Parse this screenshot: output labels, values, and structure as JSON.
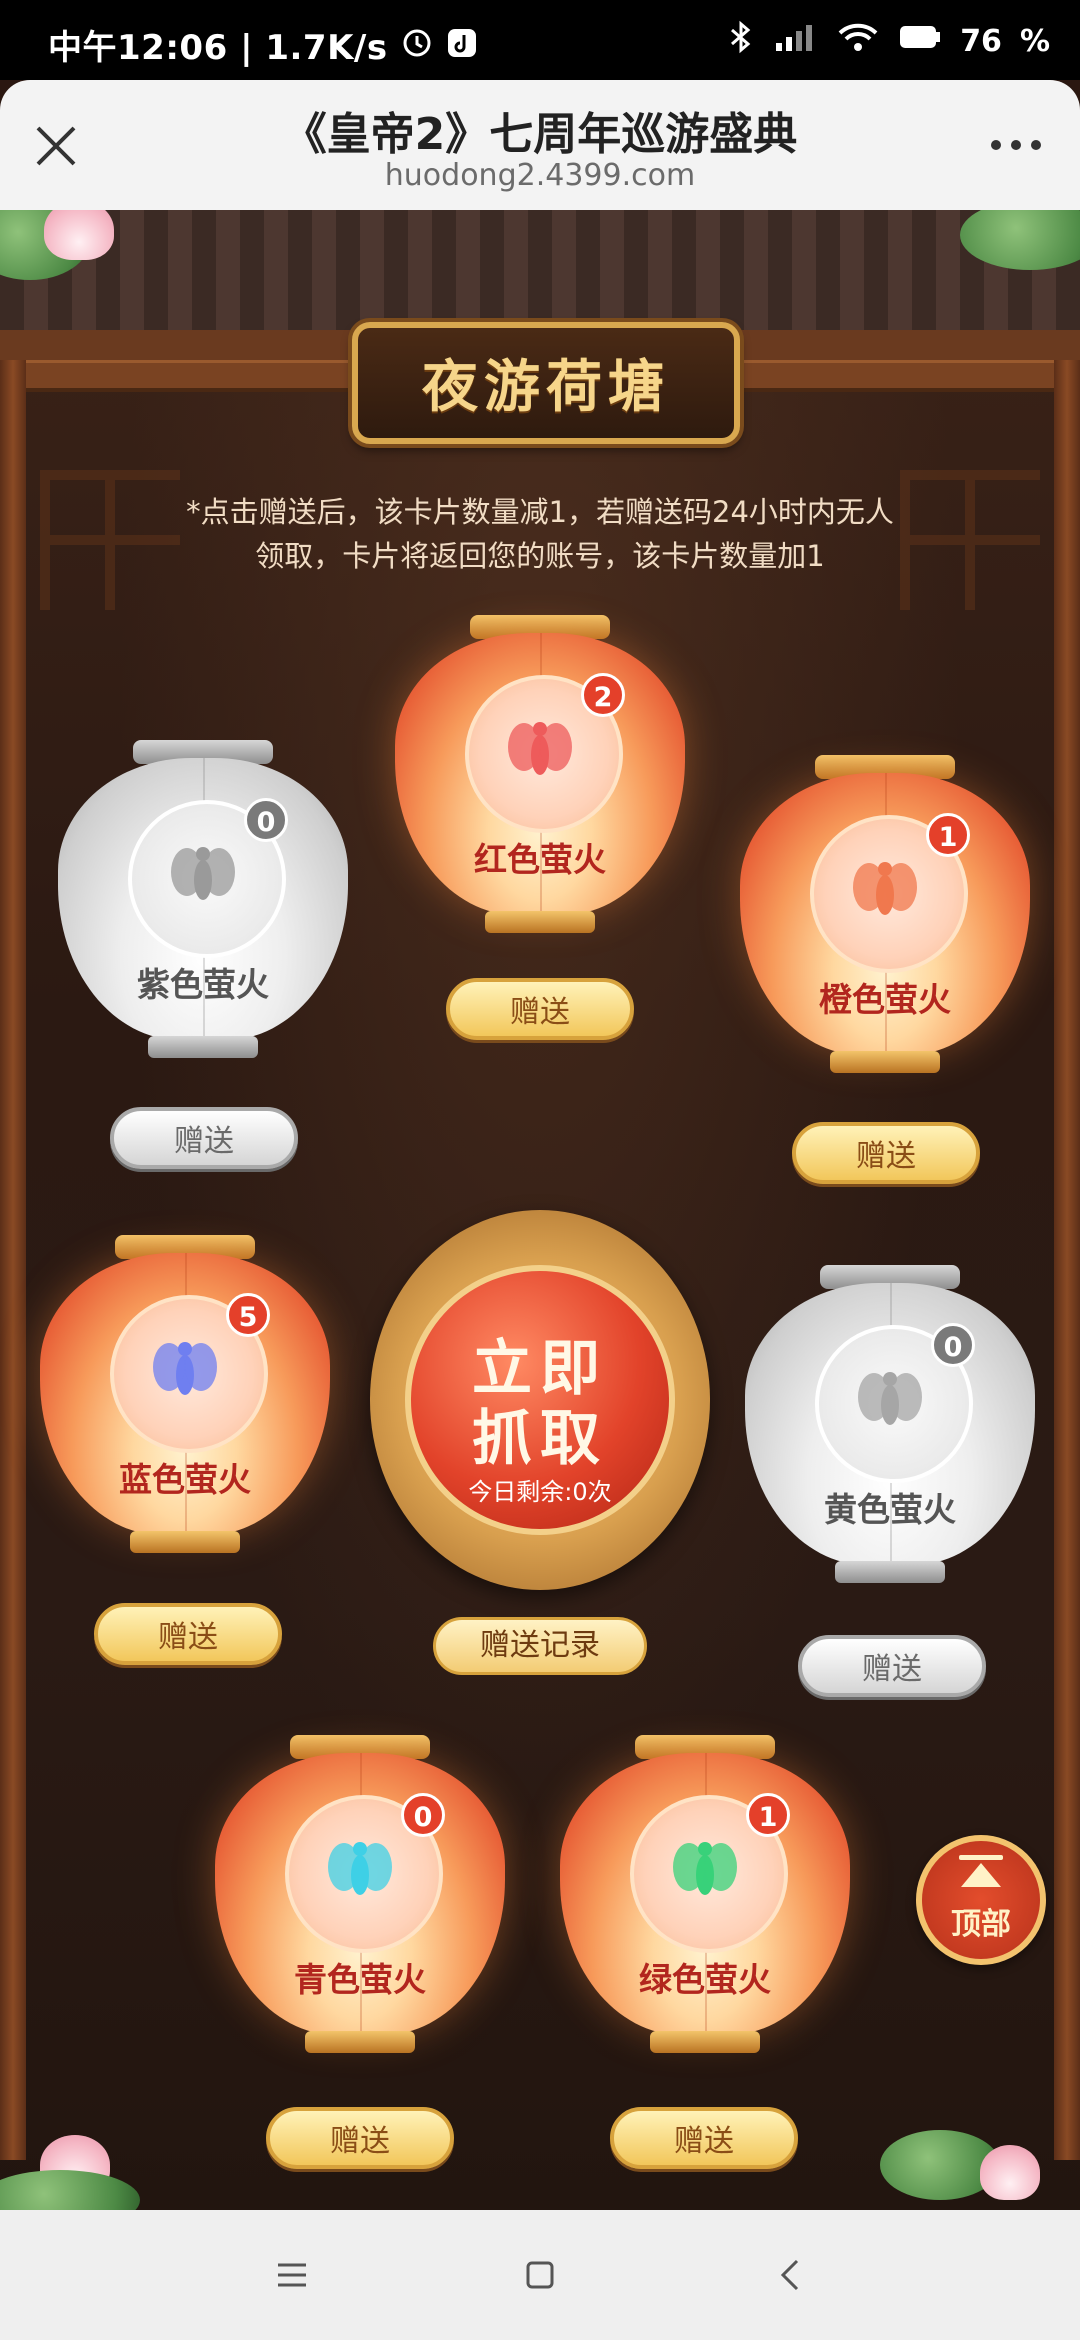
{
  "status_bar": {
    "time": "中午12:06",
    "speed": "1.7K/s",
    "battery": "76"
  },
  "browser": {
    "title": "《皇帝2》七周年巡游盛典",
    "url": "huodong2.4399.com"
  },
  "page": {
    "plaque": "夜游荷塘",
    "notice_line1": "*点击赠送后，该卡片数量减1，若赠送码24小时内无人",
    "notice_line2": "领取，卡片将返回您的账号，该卡片数量加1"
  },
  "fireflies": [
    {
      "name": "紫色萤火",
      "count": "0",
      "button": "赠送",
      "color": "#9a9a9a",
      "lit": false
    },
    {
      "name": "红色萤火",
      "count": "2",
      "button": "赠送",
      "color": "#ee5b5b",
      "lit": true
    },
    {
      "name": "橙色萤火",
      "count": "1",
      "button": "赠送",
      "color": "#f0784e",
      "lit": true
    },
    {
      "name": "蓝色萤火",
      "count": "5",
      "button": "赠送",
      "color": "#6f7ff0",
      "lit": true
    },
    {
      "name": "黄色萤火",
      "count": "0",
      "button": "赠送",
      "color": "#a6a6a6",
      "lit": false
    },
    {
      "name": "青色萤火",
      "count": "0",
      "button": "赠送",
      "color": "#3fd0e6",
      "lit": true
    },
    {
      "name": "绿色萤火",
      "count": "1",
      "button": "赠送",
      "color": "#38d17a",
      "lit": true
    }
  ],
  "grab": {
    "line1": "立即",
    "line2": "抓取",
    "remaining": "今日剩余:0次"
  },
  "record_button": "赠送记录",
  "top_button": "顶部"
}
